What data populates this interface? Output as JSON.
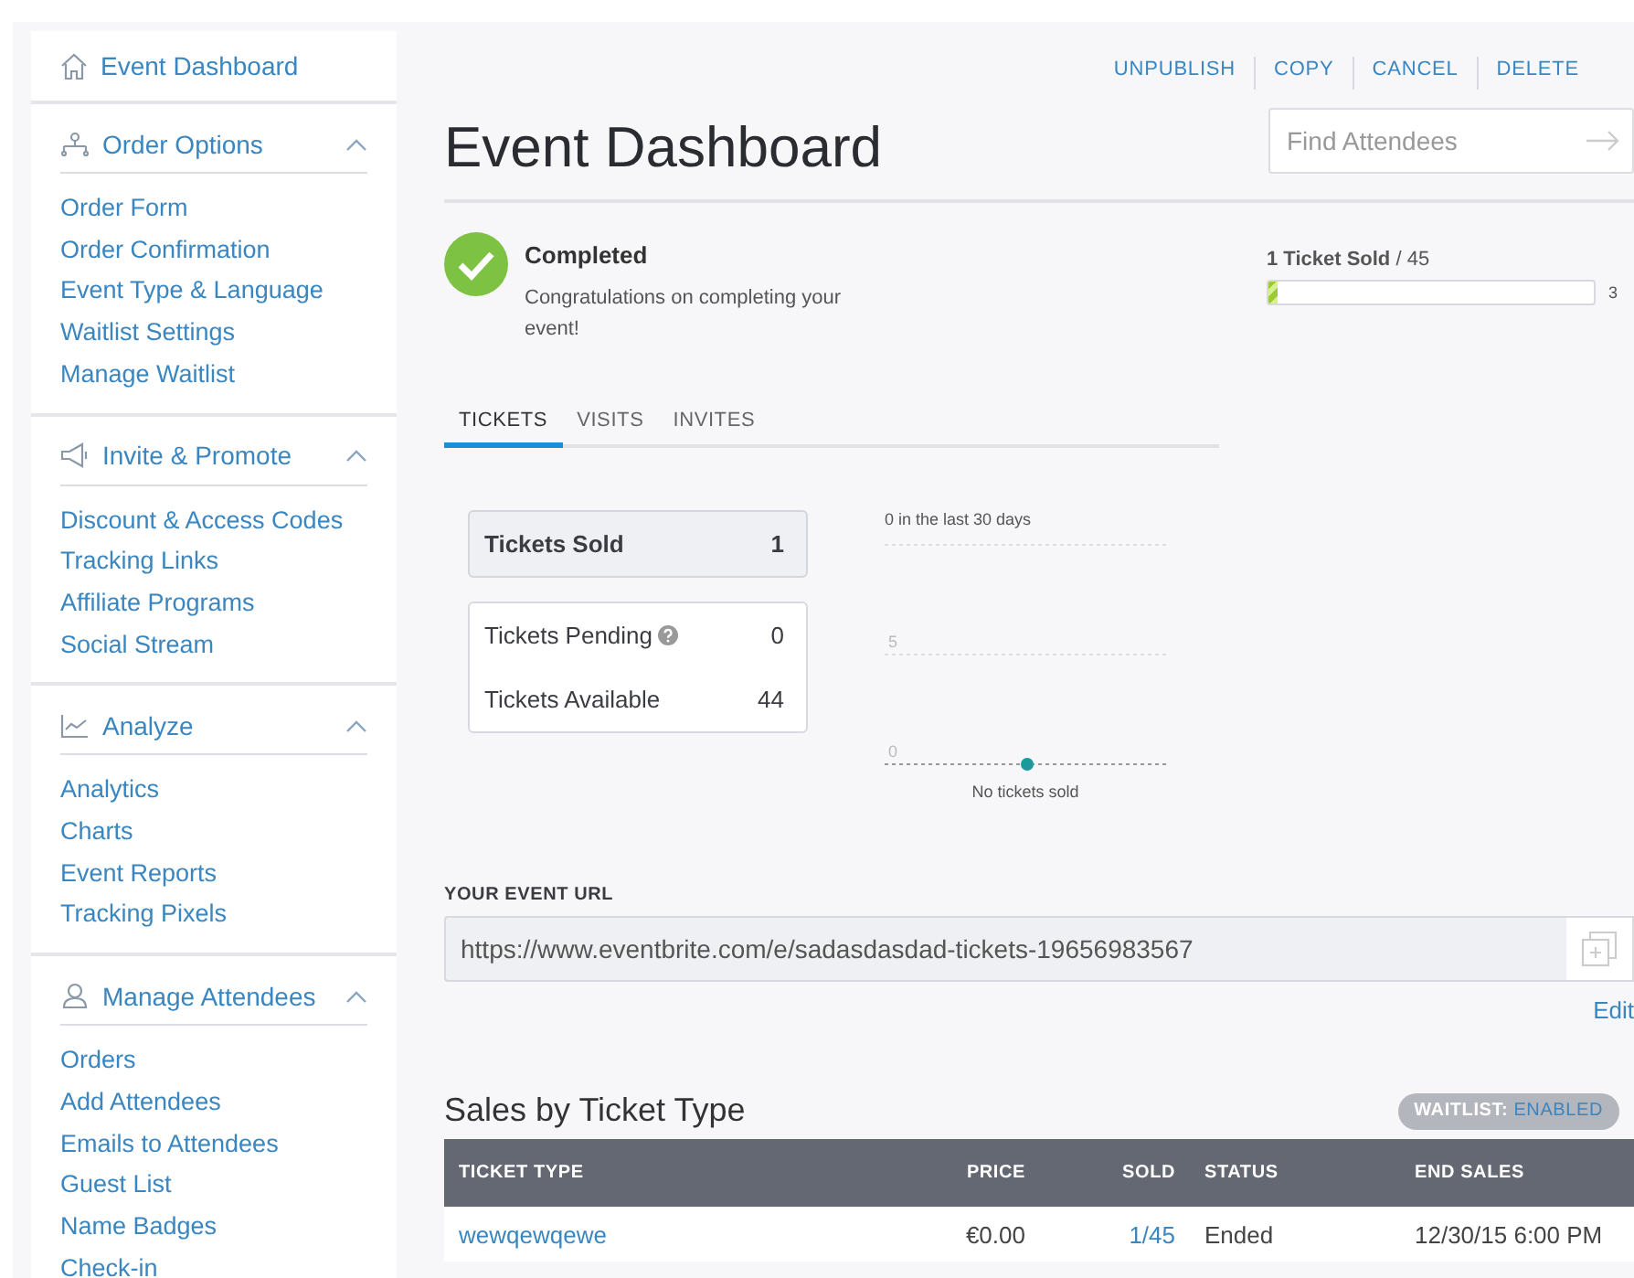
{
  "sidebar": {
    "top_item": {
      "label": "Event Dashboard"
    },
    "sections": [
      {
        "title": "Order Options",
        "expanded": true,
        "items": [
          "Order Form",
          "Order Confirmation",
          "Event Type & Language",
          "Waitlist Settings",
          "Manage Waitlist"
        ]
      },
      {
        "title": "Invite & Promote",
        "expanded": true,
        "items": [
          "Discount & Access Codes",
          "Tracking Links",
          "Affiliate Programs",
          "Social Stream"
        ]
      },
      {
        "title": "Analyze",
        "expanded": true,
        "items": [
          "Analytics",
          "Charts",
          "Event Reports",
          "Tracking Pixels"
        ]
      },
      {
        "title": "Manage Attendees",
        "expanded": true,
        "items": [
          "Orders",
          "Add Attendees",
          "Emails to Attendees",
          "Guest List",
          "Name Badges",
          "Check-in"
        ]
      }
    ]
  },
  "header_actions": [
    "UNPUBLISH",
    "COPY",
    "CANCEL",
    "DELETE"
  ],
  "title": "Event Dashboard",
  "search": {
    "placeholder": "Find Attendees"
  },
  "status": {
    "title": "Completed",
    "message": "Congratulations on completing your event!"
  },
  "sales_progress": {
    "sold": "1 Ticket Sold",
    "total": "/ 45",
    "level": 0.03,
    "percent": "3"
  },
  "tabs": [
    {
      "label": "TICKETS",
      "selected": true
    },
    {
      "label": "VISITS",
      "selected": false
    },
    {
      "label": "INVITES",
      "selected": false
    }
  ],
  "stat_cards": [
    {
      "kind": "highlight",
      "rows": [
        {
          "label": "Tickets Sold",
          "value": "1",
          "help": false
        }
      ]
    },
    {
      "kind": "plain",
      "rows": [
        {
          "label": "Tickets Pending",
          "value": "0",
          "help": true
        },
        {
          "label": "Tickets Available",
          "value": "44",
          "help": false
        }
      ]
    }
  ],
  "chart_data": {
    "type": "line",
    "title": "0 in the last 30 days",
    "yticks": [
      0,
      5
    ],
    "ylim": [
      0,
      10
    ],
    "series": [
      {
        "color": "#1a9a9a",
        "marker": true,
        "values": [
          0
        ]
      }
    ],
    "annotations": [
      "No tickets sold"
    ]
  },
  "event_url": {
    "label": "YOUR EVENT URL",
    "value": "https://www.eventbrite.com/e/sadasdasdad-tickets-19656983567",
    "edit": "Edit"
  },
  "sales": {
    "title": "Sales by Ticket Type",
    "waitlist_label": "WAITLIST:",
    "waitlist_status": "ENABLED",
    "columns": [
      "TICKET TYPE",
      "PRICE",
      "SOLD",
      "STATUS",
      "END SALES"
    ],
    "rows": [
      [
        "wewqewqewe",
        "€0.00",
        "1/45",
        "Ended",
        "12/30/15 6:00 PM"
      ]
    ]
  }
}
